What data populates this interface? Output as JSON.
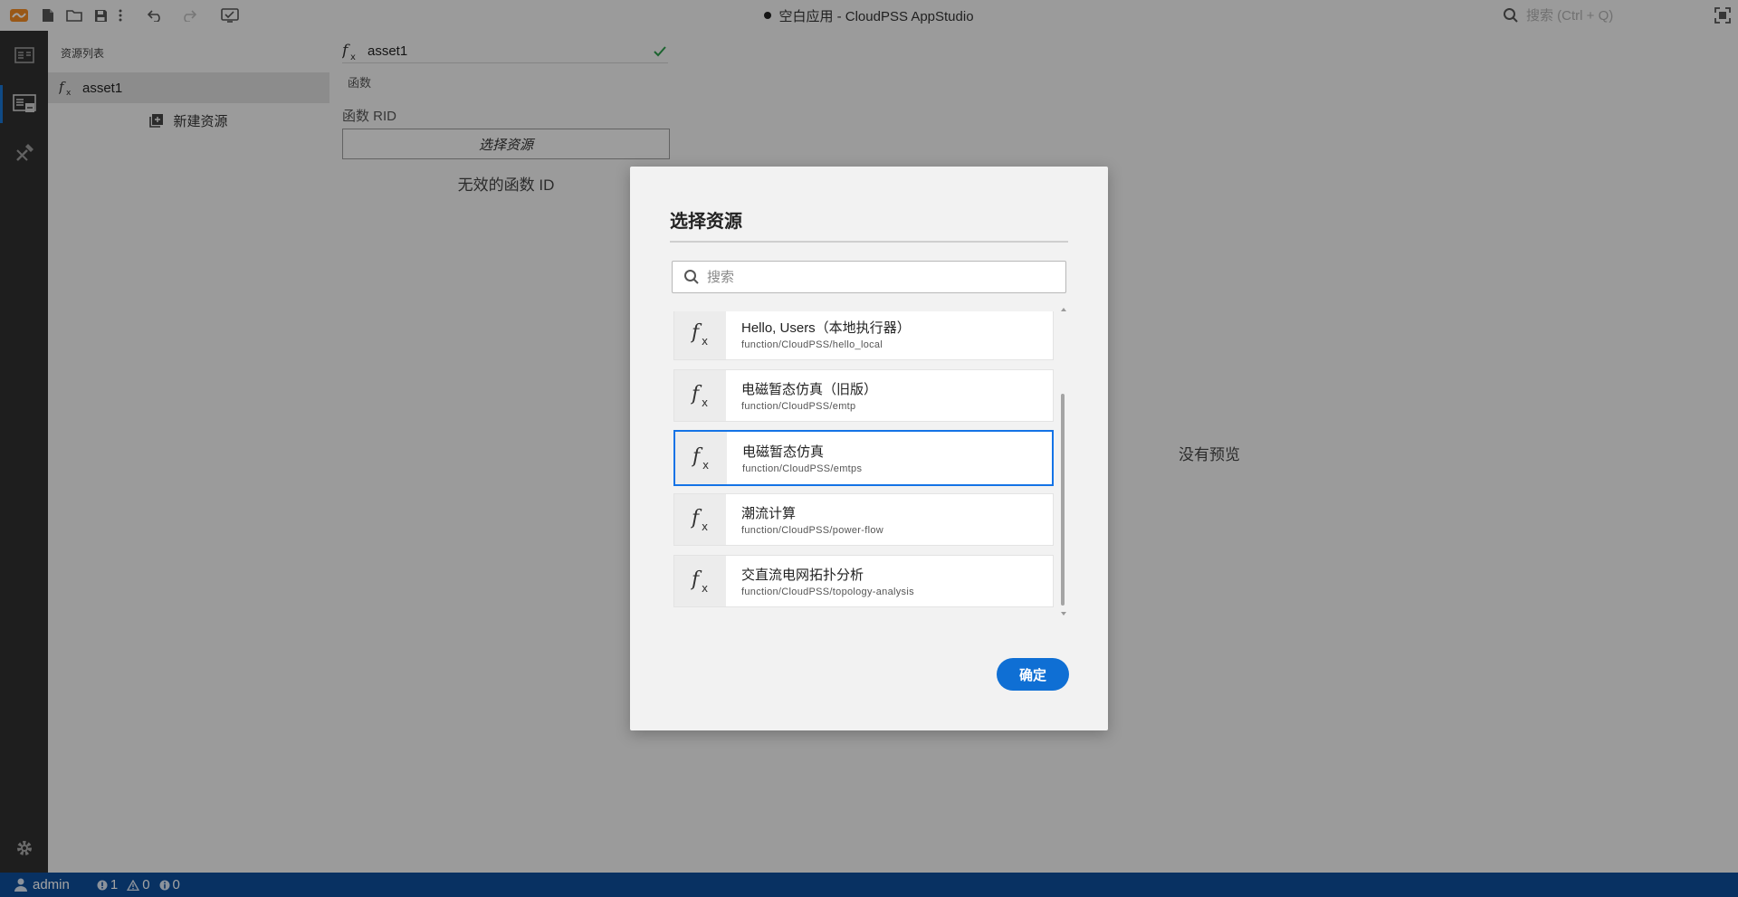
{
  "window": {
    "title": "空白应用 - CloudPSS AppStudio",
    "search_placeholder": "搜索 (Ctrl + Q)"
  },
  "toolbar": {
    "icons": [
      "app-logo-icon",
      "new-file-icon",
      "open-folder-icon",
      "save-icon",
      "more-icon",
      "undo-icon",
      "redo-icon",
      "preview-icon"
    ]
  },
  "activity_bar": {
    "items": [
      "app-panel-icon",
      "resources-icon",
      "tools-icon"
    ],
    "active_index": 1,
    "settings": "gear-icon"
  },
  "sidebar": {
    "title": "资源列表",
    "items": [
      {
        "label": "asset1",
        "icon": "function-icon"
      }
    ],
    "new_label": "新建资源"
  },
  "editor": {
    "name_value": "asset1",
    "type_label": "函数",
    "rid_label": "函数 RID",
    "select_button": "选择资源",
    "invalid_text": "无效的函数 ID"
  },
  "preview": {
    "empty_text": "没有预览"
  },
  "statusbar": {
    "user": "admin",
    "errors": "1",
    "warnings": "0",
    "infos": "0",
    "color": "#0e4d9a"
  },
  "dialog": {
    "title": "选择资源",
    "search_placeholder": "搜索",
    "items": [
      {
        "name": "Hello, Users（本地执行器）",
        "path": "function/CloudPSS/hello_local",
        "selected": false
      },
      {
        "name": "电磁暂态仿真（旧版）",
        "path": "function/CloudPSS/emtp",
        "selected": false
      },
      {
        "name": "电磁暂态仿真",
        "path": "function/CloudPSS/emtps",
        "selected": true
      },
      {
        "name": "潮流计算",
        "path": "function/CloudPSS/power-flow",
        "selected": false
      },
      {
        "name": "交直流电网拓扑分析",
        "path": "function/CloudPSS/topology-analysis",
        "selected": false
      }
    ],
    "confirm_label": "确定",
    "accent": "#1473e6"
  }
}
